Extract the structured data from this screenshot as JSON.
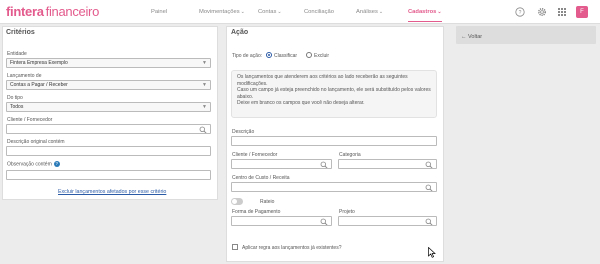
{
  "brand": {
    "name_bold": "fintera",
    "name_light": "financeiro"
  },
  "nav": {
    "items": [
      {
        "label": "Painel",
        "dropdown": false
      },
      {
        "label": "Movimentações",
        "dropdown": true
      },
      {
        "label": "Contas",
        "dropdown": true
      },
      {
        "label": "Conciliação",
        "dropdown": false
      },
      {
        "label": "Análises",
        "dropdown": true
      },
      {
        "label": "Cadastros",
        "dropdown": true,
        "active": true
      }
    ],
    "chevron": "⌄"
  },
  "user": {
    "initial": "F"
  },
  "colors": {
    "accent": "#e35a8c",
    "link": "#2a5aa6",
    "help": "#2a7ab8"
  },
  "icons": {
    "help": "help-circle-icon",
    "settings": "gear-icon",
    "apps": "grid-icon",
    "search": "search-icon",
    "select": "caret-down-icon",
    "back": "arrow-left-icon"
  },
  "criteria": {
    "title": "Critérios",
    "entidade": {
      "label": "Entidade",
      "value": "Fintera Empresa Exemplo"
    },
    "lancamento": {
      "label": "Lançamento de",
      "value": "Contas a Pagar / Receber"
    },
    "tipo": {
      "label": "Do tipo",
      "value": "Todos"
    },
    "cliente": {
      "label": "Cliente / Fornecedor",
      "value": ""
    },
    "descricao": {
      "label": "Descrição original contém",
      "value": ""
    },
    "observacao": {
      "label": "Observação contém",
      "help": "?",
      "value": ""
    },
    "delete_link": "Excluir lançamentos afetados por esse critério"
  },
  "action": {
    "title": "Ação",
    "type_label": "Tipo de ação:",
    "options": [
      "Classificar",
      "Excluir"
    ],
    "selected": "Classificar",
    "info": [
      "Os lançamentos que atenderem aos critérios ao lado receberão as seguintes modificações.",
      "Caso um campo já esteja preenchido no lançamento, ele será substituído pelos valores abaixo.",
      "Deixe em branco os campos que você não deseja alterar."
    ],
    "descricao": {
      "label": "Descrição",
      "value": ""
    },
    "cliente": {
      "label": "Cliente / Fornecedor",
      "value": ""
    },
    "categoria": {
      "label": "Categoria",
      "value": ""
    },
    "centro": {
      "label": "Centro de Custo / Receita",
      "value": ""
    },
    "rateio": {
      "label": "Rateio",
      "enabled": false
    },
    "forma": {
      "label": "Forma de Pagamento",
      "value": ""
    },
    "projeto": {
      "label": "Projeto",
      "value": ""
    },
    "apply_existing": {
      "label": "Aplicar regra aos lançamentos já existentes?",
      "checked": false
    }
  },
  "side": {
    "back": "← Voltar"
  }
}
